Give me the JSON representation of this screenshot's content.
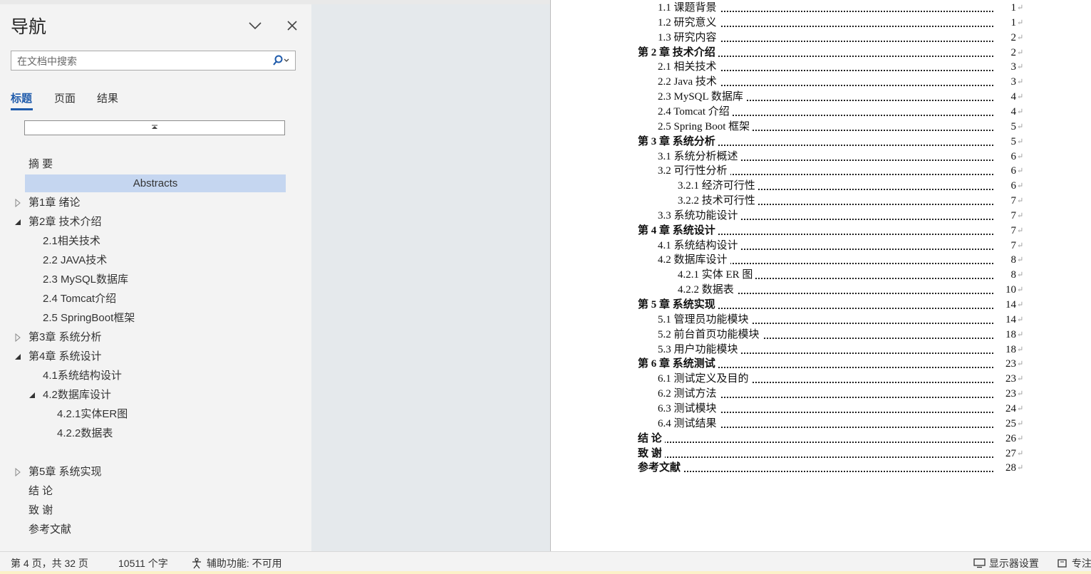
{
  "nav": {
    "title": "导航",
    "search_placeholder": "在文档中搜索",
    "tabs": [
      {
        "label": "标题",
        "active": true
      },
      {
        "label": "页面",
        "active": false
      },
      {
        "label": "结果",
        "active": false
      }
    ],
    "headings": [
      {
        "label": "摘  要",
        "level": 1,
        "expander": "none"
      },
      {
        "label": "Abstracts",
        "level": 1,
        "expander": "none",
        "selected": true
      },
      {
        "label": "第1章 绪论",
        "level": 1,
        "expander": "collapsed"
      },
      {
        "label": "第2章 技术介绍",
        "level": 1,
        "expander": "expanded"
      },
      {
        "label": "2.1相关技术",
        "level": 2,
        "expander": "none"
      },
      {
        "label": "2.2 JAVA技术",
        "level": 2,
        "expander": "none"
      },
      {
        "label": "2.3 MySQL数据库",
        "level": 2,
        "expander": "none"
      },
      {
        "label": "2.4 Tomcat介绍",
        "level": 2,
        "expander": "none"
      },
      {
        "label": "2.5 SpringBoot框架",
        "level": 2,
        "expander": "none"
      },
      {
        "label": "第3章 系统分析",
        "level": 1,
        "expander": "collapsed"
      },
      {
        "label": "第4章 系统设计",
        "level": 1,
        "expander": "expanded"
      },
      {
        "label": "4.1系统结构设计",
        "level": 2,
        "expander": "none"
      },
      {
        "label": "4.2数据库设计",
        "level": 2,
        "expander": "expanded"
      },
      {
        "label": "4.2.1实体ER图",
        "level": 3,
        "expander": "none"
      },
      {
        "label": "4.2.2数据表",
        "level": 3,
        "expander": "none"
      },
      {
        "label": "",
        "level": 1,
        "expander": "none"
      },
      {
        "label": "第5章 系统实现",
        "level": 1,
        "expander": "collapsed"
      },
      {
        "label": "结  论",
        "level": 1,
        "expander": "none"
      },
      {
        "label": "致  谢",
        "level": 1,
        "expander": "none"
      },
      {
        "label": "参考文献",
        "level": 1,
        "expander": "none"
      }
    ]
  },
  "toc": [
    {
      "label": "1.1 课题背景",
      "page": "1",
      "level": 2
    },
    {
      "label": "1.2 研究意义",
      "page": "1",
      "level": 2
    },
    {
      "label": "1.3 研究内容",
      "page": "2",
      "level": 2
    },
    {
      "label": "第 2 章  技术介绍",
      "page": "2",
      "level": 1
    },
    {
      "label": "2.1 相关技术",
      "page": "3",
      "level": 2
    },
    {
      "label": "2.2  Java 技术",
      "page": "3",
      "level": 2
    },
    {
      "label": "2.3  MySQL 数据库",
      "page": "4",
      "level": 2
    },
    {
      "label": "2.4  Tomcat 介绍",
      "page": "4",
      "level": 2
    },
    {
      "label": "2.5  Spring   Boot 框架",
      "page": "5",
      "level": 2
    },
    {
      "label": "第 3 章  系统分析",
      "page": "5",
      "level": 1
    },
    {
      "label": "3.1 系统分析概述",
      "page": "6",
      "level": 2
    },
    {
      "label": "3.2 可行性分析",
      "page": "6",
      "level": 2
    },
    {
      "label": "3.2.1 经济可行性",
      "page": "6",
      "level": 3
    },
    {
      "label": "3.2.2 技术可行性",
      "page": "7",
      "level": 3
    },
    {
      "label": "3.3 系统功能设计",
      "page": "7",
      "level": 2
    },
    {
      "label": "第 4 章  系统设计",
      "page": "7",
      "level": 1
    },
    {
      "label": "4.1 系统结构设计",
      "page": "7",
      "level": 2
    },
    {
      "label": "4.2 数据库设计",
      "page": "8",
      "level": 2
    },
    {
      "label": "4.2.1 实体 ER 图",
      "page": "8",
      "level": 3
    },
    {
      "label": "4.2.2 数据表",
      "page": "10",
      "level": 3
    },
    {
      "label": "第 5 章  系统实现",
      "page": "14",
      "level": 1
    },
    {
      "label": "5.1 管理员功能模块",
      "page": "14",
      "level": 2
    },
    {
      "label": "5.2 前台首页功能模块",
      "page": "18",
      "level": 2
    },
    {
      "label": "5.3 用户功能模块",
      "page": "18",
      "level": 2
    },
    {
      "label": "第 6 章  系统测试",
      "page": "23",
      "level": 1
    },
    {
      "label": "6.1 测试定义及目的",
      "page": "23",
      "level": 2
    },
    {
      "label": "6.2 测试方法",
      "page": "23",
      "level": 2
    },
    {
      "label": "6.3 测试模块",
      "page": "24",
      "level": 2
    },
    {
      "label": "6.4 测试结果",
      "page": "25",
      "level": 2
    },
    {
      "label": "结   论",
      "page": "26",
      "level": 1
    },
    {
      "label": "致   谢",
      "page": "27",
      "level": 1
    },
    {
      "label": "参考文献",
      "page": "28",
      "level": 1
    }
  ],
  "paragraph_mark": "↵",
  "status": {
    "page_info": "第 4 页，共 32 页",
    "word_count": "10511 个字",
    "accessibility": "辅助功能: 不可用",
    "display_settings": "显示器设置",
    "focus": "专注"
  },
  "colors": {
    "accent": "#1f5bab",
    "selected_bg": "#c5d6f0"
  }
}
